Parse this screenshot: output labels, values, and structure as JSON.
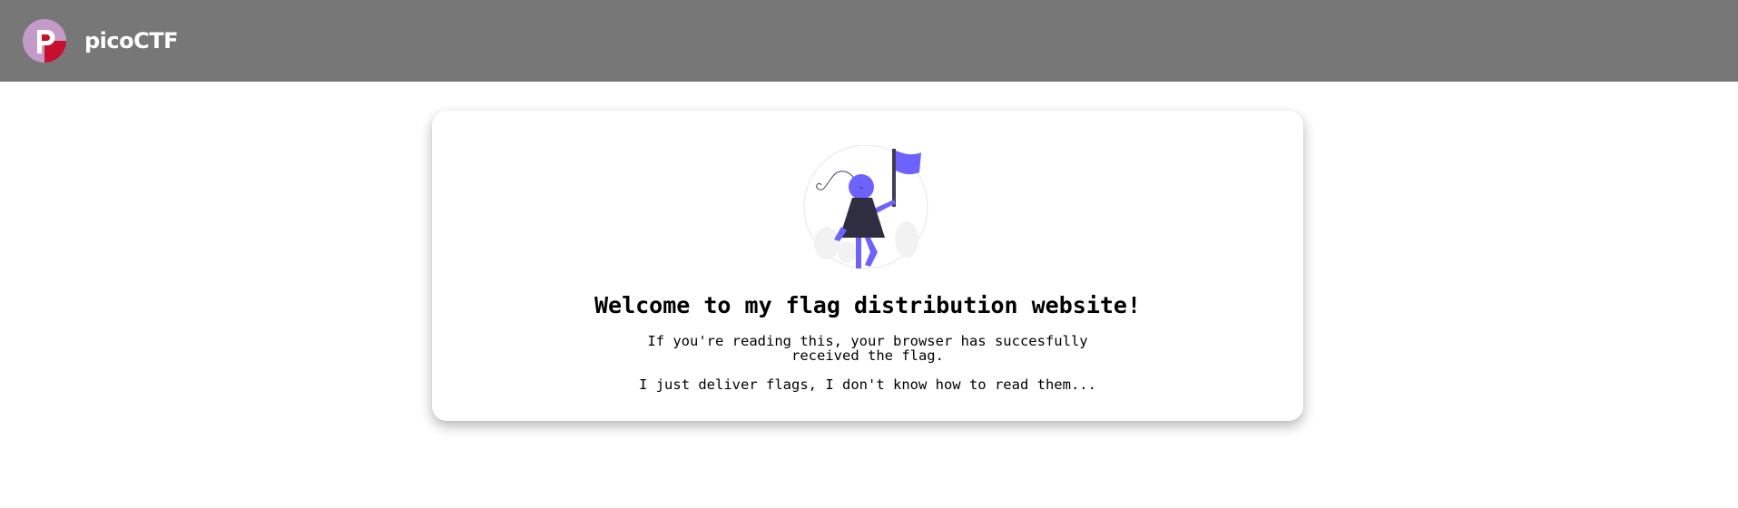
{
  "navbar": {
    "brand_name": "picoCTF",
    "background_color": "#777777",
    "logo_icon": "picoctf-logo-icon",
    "logo_letter": "P"
  },
  "card": {
    "illustration_icon": "person-with-flag-icon",
    "accent_color": "#6c63ff",
    "title": "Welcome to my flag distribution website!",
    "paragraph1_line1": "If you're reading this, your browser has succesfully",
    "paragraph1_line2": "received the flag.",
    "paragraph2": "I just deliver flags, I don't know how to read them..."
  }
}
